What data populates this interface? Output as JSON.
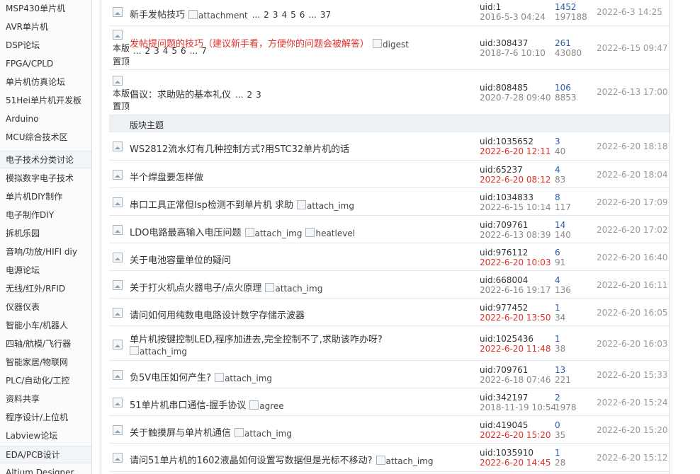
{
  "sidebar": {
    "items": [
      {
        "label": "MSP430单片机",
        "group": false
      },
      {
        "label": "AVR单片机",
        "group": false
      },
      {
        "label": "DSP论坛",
        "group": false
      },
      {
        "label": "FPGA/CPLD",
        "group": false
      },
      {
        "label": "单片机仿真论坛",
        "group": false
      },
      {
        "label": "51Hei单片机开发板",
        "group": false
      },
      {
        "label": "Arduino",
        "group": false
      },
      {
        "label": "MCU综合技术区",
        "group": false
      },
      {
        "label": "电子技术分类讨论",
        "group": true
      },
      {
        "label": "模拟数字电子技术",
        "group": false
      },
      {
        "label": "单片机DIY制作",
        "group": false
      },
      {
        "label": "电子制作DIY",
        "group": false
      },
      {
        "label": "拆机乐园",
        "group": false
      },
      {
        "label": "音响/功放/HIFI diy",
        "group": false
      },
      {
        "label": "电源论坛",
        "group": false
      },
      {
        "label": "无线/红外/RFID",
        "group": false
      },
      {
        "label": "仪器仪表",
        "group": false
      },
      {
        "label": "智能小车/机器人",
        "group": false
      },
      {
        "label": "四轴/航模/飞行器",
        "group": false
      },
      {
        "label": "智能家居/物联网",
        "group": false
      },
      {
        "label": "PLC/自动化/工控",
        "group": false
      },
      {
        "label": "资料共享",
        "group": false
      },
      {
        "label": "程序设计/上位机",
        "group": false
      },
      {
        "label": "Labview论坛",
        "group": false
      },
      {
        "label": "EDA/PCB设计",
        "group": true
      },
      {
        "label": "Altium Designer",
        "group": false
      }
    ]
  },
  "pinned_label": "本版",
  "pinned_text": "置顶",
  "section_label": "版块主题",
  "pinned": [
    {
      "title": "新手发帖技巧",
      "red": false,
      "tags": [
        "attachment"
      ],
      "pages": [
        "...",
        "2",
        "3",
        "4",
        "5",
        "6",
        "...",
        "37"
      ],
      "uid": "uid:1",
      "date": "2016-5-3 04:24",
      "date_new": false,
      "replies": "1452",
      "views": "197188",
      "last": "2022-6-3 14:25"
    },
    {
      "title": "发帖提问题的技巧（建议新手看，方便你的问题会被解答）",
      "red": true,
      "tags": [
        "digest"
      ],
      "pages": [
        "...",
        "2",
        "3",
        "4",
        "5",
        "6",
        "...",
        "7"
      ],
      "uid": "uid:308437",
      "date": "2018-7-6 10:10",
      "date_new": false,
      "replies": "261",
      "views": "43080",
      "last": "2022-6-15 09:47"
    },
    {
      "title": "倡议：求助贴的基本礼仪",
      "red": false,
      "tags": [],
      "pages": [
        "...",
        "2",
        "3"
      ],
      "uid": "uid:808485",
      "date": "2020-7-28 09:40",
      "date_new": false,
      "replies": "106",
      "views": "8853",
      "last": "2022-6-13 17:00"
    }
  ],
  "threads": [
    {
      "title": "WS2812流水灯有几种控制方式?用STC32单片机的话",
      "tags": [],
      "uid": "uid:1035652",
      "date": "2022-6-20 12:11",
      "date_new": true,
      "replies": "3",
      "views": "40",
      "last": "2022-6-20 18:18"
    },
    {
      "title": "半个焊盘要怎样做",
      "tags": [],
      "uid": "uid:65237",
      "date": "2022-6-20 08:12",
      "date_new": true,
      "replies": "4",
      "views": "83",
      "last": "2022-6-20 18:04"
    },
    {
      "title": "串口工具正常但Isp检测不到单片机 求助",
      "tags": [
        "attach_img"
      ],
      "uid": "uid:1034833",
      "date": "2022-6-15 10:14",
      "date_new": false,
      "replies": "8",
      "views": "117",
      "last": "2022-6-20 17:09"
    },
    {
      "title": "LDO电路最高输入电压问题",
      "tags": [
        "attach_img",
        "heatlevel"
      ],
      "uid": "uid:709761",
      "date": "2022-6-13 08:39",
      "date_new": false,
      "replies": "14",
      "views": "140",
      "last": "2022-6-20 17:02"
    },
    {
      "title": "关于电池容量单位的疑问",
      "tags": [],
      "uid": "uid:976112",
      "date": "2022-6-20 10:03",
      "date_new": true,
      "replies": "6",
      "views": "91",
      "last": "2022-6-20 16:40"
    },
    {
      "title": "关于打火机点火器电子/点火原理",
      "tags": [
        "attach_img"
      ],
      "uid": "uid:668004",
      "date": "2022-6-16 19:17",
      "date_new": false,
      "replies": "4",
      "views": "136",
      "last": "2022-6-20 16:11"
    },
    {
      "title": "请问如何用纯数电电路设计数字存储示波器",
      "tags": [],
      "uid": "uid:977452",
      "date": "2022-6-20 13:50",
      "date_new": true,
      "replies": "1",
      "views": "34",
      "last": "2022-6-20 16:05"
    },
    {
      "title": "单片机按键控制LED,程序加进去,完全控制不了,求助该咋办呀?",
      "tags": [
        "attach_img"
      ],
      "uid": "uid:1025436",
      "date": "2022-6-20 11:48",
      "date_new": true,
      "replies": "1",
      "views": "38",
      "last": "2022-6-20 16:03",
      "wrap": true
    },
    {
      "title": "负5V电压如何产生?",
      "tags": [
        "attach_img"
      ],
      "uid": "uid:709761",
      "date": "2022-6-18 07:46",
      "date_new": false,
      "replies": "13",
      "views": "221",
      "last": "2022-6-20 15:33"
    },
    {
      "title": "51单片机串口通信-握手协议",
      "tags": [
        "agree"
      ],
      "uid": "uid:342197",
      "date": "2018-11-19 10:54",
      "date_new": false,
      "replies": "2",
      "views": "1978",
      "last": "2022-6-20 15:24"
    },
    {
      "title": "关于触摸屏与单片机通信",
      "tags": [
        "attach_img"
      ],
      "uid": "uid:419045",
      "date": "2022-6-20 15:20",
      "date_new": true,
      "replies": "0",
      "views": "35",
      "last": "2022-6-20 15:20"
    },
    {
      "title": "请问51单片机的1602液晶如何设置写数据但是光标不移动?",
      "tags": [
        "attach_img"
      ],
      "uid": "uid:1035910",
      "date": "2022-6-20 14:45",
      "date_new": true,
      "replies": "1",
      "views": "28",
      "last": "2022-6-20 15:12"
    }
  ]
}
